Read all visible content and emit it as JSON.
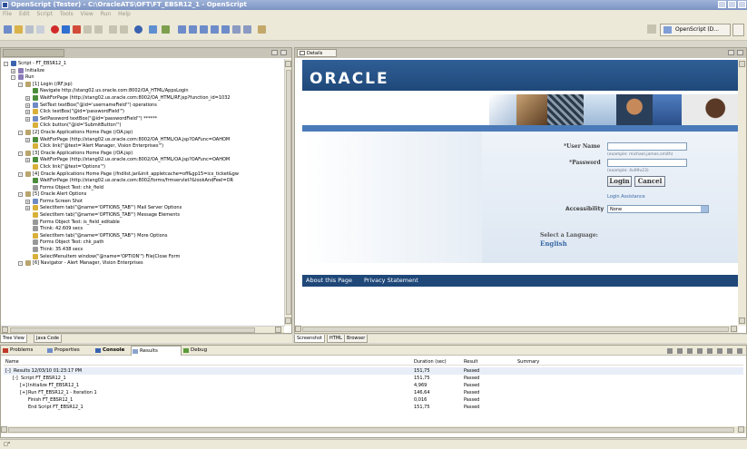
{
  "window": {
    "title": "OpenScript (Tester) - C:\\OracleATS\\OFT\\FT_EBSR12_1 - OpenScript"
  },
  "menu": [
    "File",
    "Edit",
    "Script",
    "Tools",
    "View",
    "Run",
    "Help"
  ],
  "toolbar": {
    "perspective_label": "OpenScript (D..."
  },
  "left_view": {
    "bottom_tabs": [
      "Tree View",
      "Java Code"
    ],
    "tree": [
      {
        "indent": 0,
        "exp": "-",
        "icon": "script",
        "text": "Script - FT_EBSR12_1"
      },
      {
        "indent": 1,
        "exp": "+",
        "icon": "folder",
        "text": "Initialize"
      },
      {
        "indent": 1,
        "exp": "-",
        "icon": "folder",
        "text": "Run"
      },
      {
        "indent": 2,
        "exp": "-",
        "icon": "page",
        "text": "[1] Login (/RF.jsp)"
      },
      {
        "indent": 3,
        "exp": "",
        "icon": "nav",
        "text": "Navigate http://stang02.us.oracle.com:8002/OA_HTML/AppsLogin"
      },
      {
        "indent": 3,
        "exp": "+",
        "icon": "wait",
        "text": "WaitForPage (http://stang02.us.oracle.com:8002/OA_HTML/RF.jsp?function_id=1032"
      },
      {
        "indent": 3,
        "exp": "+",
        "icon": "text",
        "text": "SetText textBox(\"@id='usernameField'\") operations"
      },
      {
        "indent": 3,
        "exp": "+",
        "icon": "click",
        "text": "Click textBox(\"@id='passwordField'\")"
      },
      {
        "indent": 3,
        "exp": "+",
        "icon": "text",
        "text": "SetPassword textBox(\"@id='passwordField'\") ******"
      },
      {
        "indent": 3,
        "exp": "",
        "icon": "click",
        "text": "Click button(\"@id='SubmitButton'\")"
      },
      {
        "indent": 2,
        "exp": "-",
        "icon": "page",
        "text": "[2] Oracle Applications Home Page (/OA.jsp)"
      },
      {
        "indent": 3,
        "exp": "+",
        "icon": "wait",
        "text": "WaitForPage (http://stang02.us.oracle.com:8002/OA_HTML/OA.jsp?OAFunc=OAHOM"
      },
      {
        "indent": 3,
        "exp": "",
        "icon": "click",
        "text": "Click link(\"@text='Alert Manager, Vision Enterprises'\")"
      },
      {
        "indent": 2,
        "exp": "-",
        "icon": "page",
        "text": "[3] Oracle Applications Home Page (/OA.jsp)"
      },
      {
        "indent": 3,
        "exp": "+",
        "icon": "wait",
        "text": "WaitForPage (http://stang02.us.oracle.com:8002/OA_HTML/OA.jsp?OAFunc=OAHOM"
      },
      {
        "indent": 3,
        "exp": "",
        "icon": "click",
        "text": "Click link(\"@text='Options'\")"
      },
      {
        "indent": 2,
        "exp": "-",
        "icon": "page",
        "text": "[4] Oracle Applications Home Page (/fndlist.jar&init_appletcache=off&gp15=icx_ticket&gw"
      },
      {
        "indent": 3,
        "exp": "",
        "icon": "nav",
        "text": "WaitForPage (http://stang02.us.oracle.com:8002/forms/frmservlet?&lookAndFeel=OR"
      },
      {
        "indent": 3,
        "exp": "",
        "icon": "test",
        "text": "Forms Object Test: chk_field"
      },
      {
        "indent": 2,
        "exp": "-",
        "icon": "page",
        "text": "[5] Oracle Alert Options"
      },
      {
        "indent": 3,
        "exp": "+",
        "icon": "shot",
        "text": "Forms Screen Shot"
      },
      {
        "indent": 3,
        "exp": "+",
        "icon": "click",
        "text": "SelectItem tab(\"@name='OPTIONS_TAB'\") Mail Server Options"
      },
      {
        "indent": 3,
        "exp": "",
        "icon": "click",
        "text": "SelectItem tab(\"@name='OPTIONS_TAB'\") Message Elements"
      },
      {
        "indent": 3,
        "exp": "",
        "icon": "test",
        "text": "Forms Object Test: is_field_editable"
      },
      {
        "indent": 3,
        "exp": "",
        "icon": "think",
        "text": "Think: 42.609 secs"
      },
      {
        "indent": 3,
        "exp": "",
        "icon": "click",
        "text": "SelectItem tab(\"@name='OPTIONS_TAB'\") More Options"
      },
      {
        "indent": 3,
        "exp": "",
        "icon": "test",
        "text": "Forms Object Test: chk_path"
      },
      {
        "indent": 3,
        "exp": "",
        "icon": "think",
        "text": "Think: 35.438 secs"
      },
      {
        "indent": 3,
        "exp": "",
        "icon": "click",
        "text": "SelectMenuItem window(\"@name='OPTION'\") File|Close Form"
      },
      {
        "indent": 2,
        "exp": "-",
        "icon": "page",
        "text": "[6] Navigator - Alert Manager, Vision Enterprises"
      }
    ]
  },
  "right_view": {
    "tab": "Details",
    "bottom_tabs": [
      "Screenshot",
      "HTML",
      "Browser"
    ],
    "oracle": {
      "logo": "ORACLE",
      "user_label": "*User Name",
      "user_hint": "(example: michael.james.smith)",
      "pass_label": "*Password",
      "pass_hint": "(example: 4u99v23)",
      "login_btn": "Login",
      "cancel_btn": "Cancel",
      "assist": "Login Assistance",
      "access_label": "Accessibility",
      "access_value": "None",
      "lang_title": "Select a Language:",
      "lang_value": "English",
      "footer_about": "About this Page",
      "footer_privacy": "Privacy Statement"
    }
  },
  "bottom": {
    "tabs": [
      "Problems",
      "Properties",
      "Console",
      "Results",
      "Debug"
    ],
    "headers": {
      "name": "Name",
      "duration": "Duration (sec)",
      "result": "Result",
      "summary": "Summary"
    },
    "rows": [
      {
        "indent": 0,
        "exp": "-",
        "name": "Results 12/03/10 01:23:17 PM",
        "duration": "151,75",
        "result": "Passed"
      },
      {
        "indent": 1,
        "exp": "-",
        "name": "Script FT_EBSR12_1",
        "duration": "151,75",
        "result": "Passed"
      },
      {
        "indent": 2,
        "exp": "+",
        "name": "Initialize FT_EBSR12_1",
        "duration": "4,969",
        "result": "Passed"
      },
      {
        "indent": 2,
        "exp": "+",
        "name": "Run FT_EBSR12_1 - Iteration 1",
        "duration": "146,64",
        "result": "Passed"
      },
      {
        "indent": 2,
        "exp": "",
        "name": "Finish FT_EBSR12_1",
        "duration": "0,016",
        "result": "Passed"
      },
      {
        "indent": 2,
        "exp": "",
        "name": "End Script FT_EBSR12_1",
        "duration": "151,75",
        "result": "Passed"
      }
    ]
  },
  "status": {
    "left": "□°"
  }
}
